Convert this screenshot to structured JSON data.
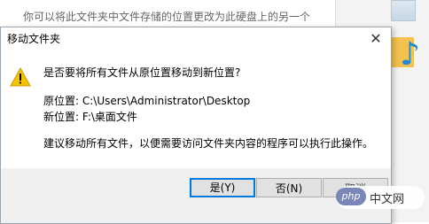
{
  "background": {
    "text": "你可以将此文件夹中文件存储的位置更改为此硬盘上的另一个"
  },
  "dialog": {
    "title": "移动文件夹",
    "question": "是否要将所有文件从原位置移动到新位置?",
    "original_location": "原位置: C:\\Users\\Administrator\\Desktop",
    "new_location": "新位置: F:\\桌面文件",
    "advice": "建议移动所有文件，以便需要访问文件夹内容的程序可以执行此操作。",
    "buttons": {
      "yes": "是(Y)",
      "no": "否(N)",
      "cancel": "取消"
    }
  },
  "watermark": {
    "logo": "php",
    "text": "中文网"
  },
  "colors": {
    "accent": "#0078d7",
    "warning": "#f5c400",
    "button_bar": "#f0f0f0"
  },
  "icons": [
    "warning-icon",
    "close-icon",
    "image-file-icon",
    "folder-icon",
    "music-note-icon"
  ]
}
